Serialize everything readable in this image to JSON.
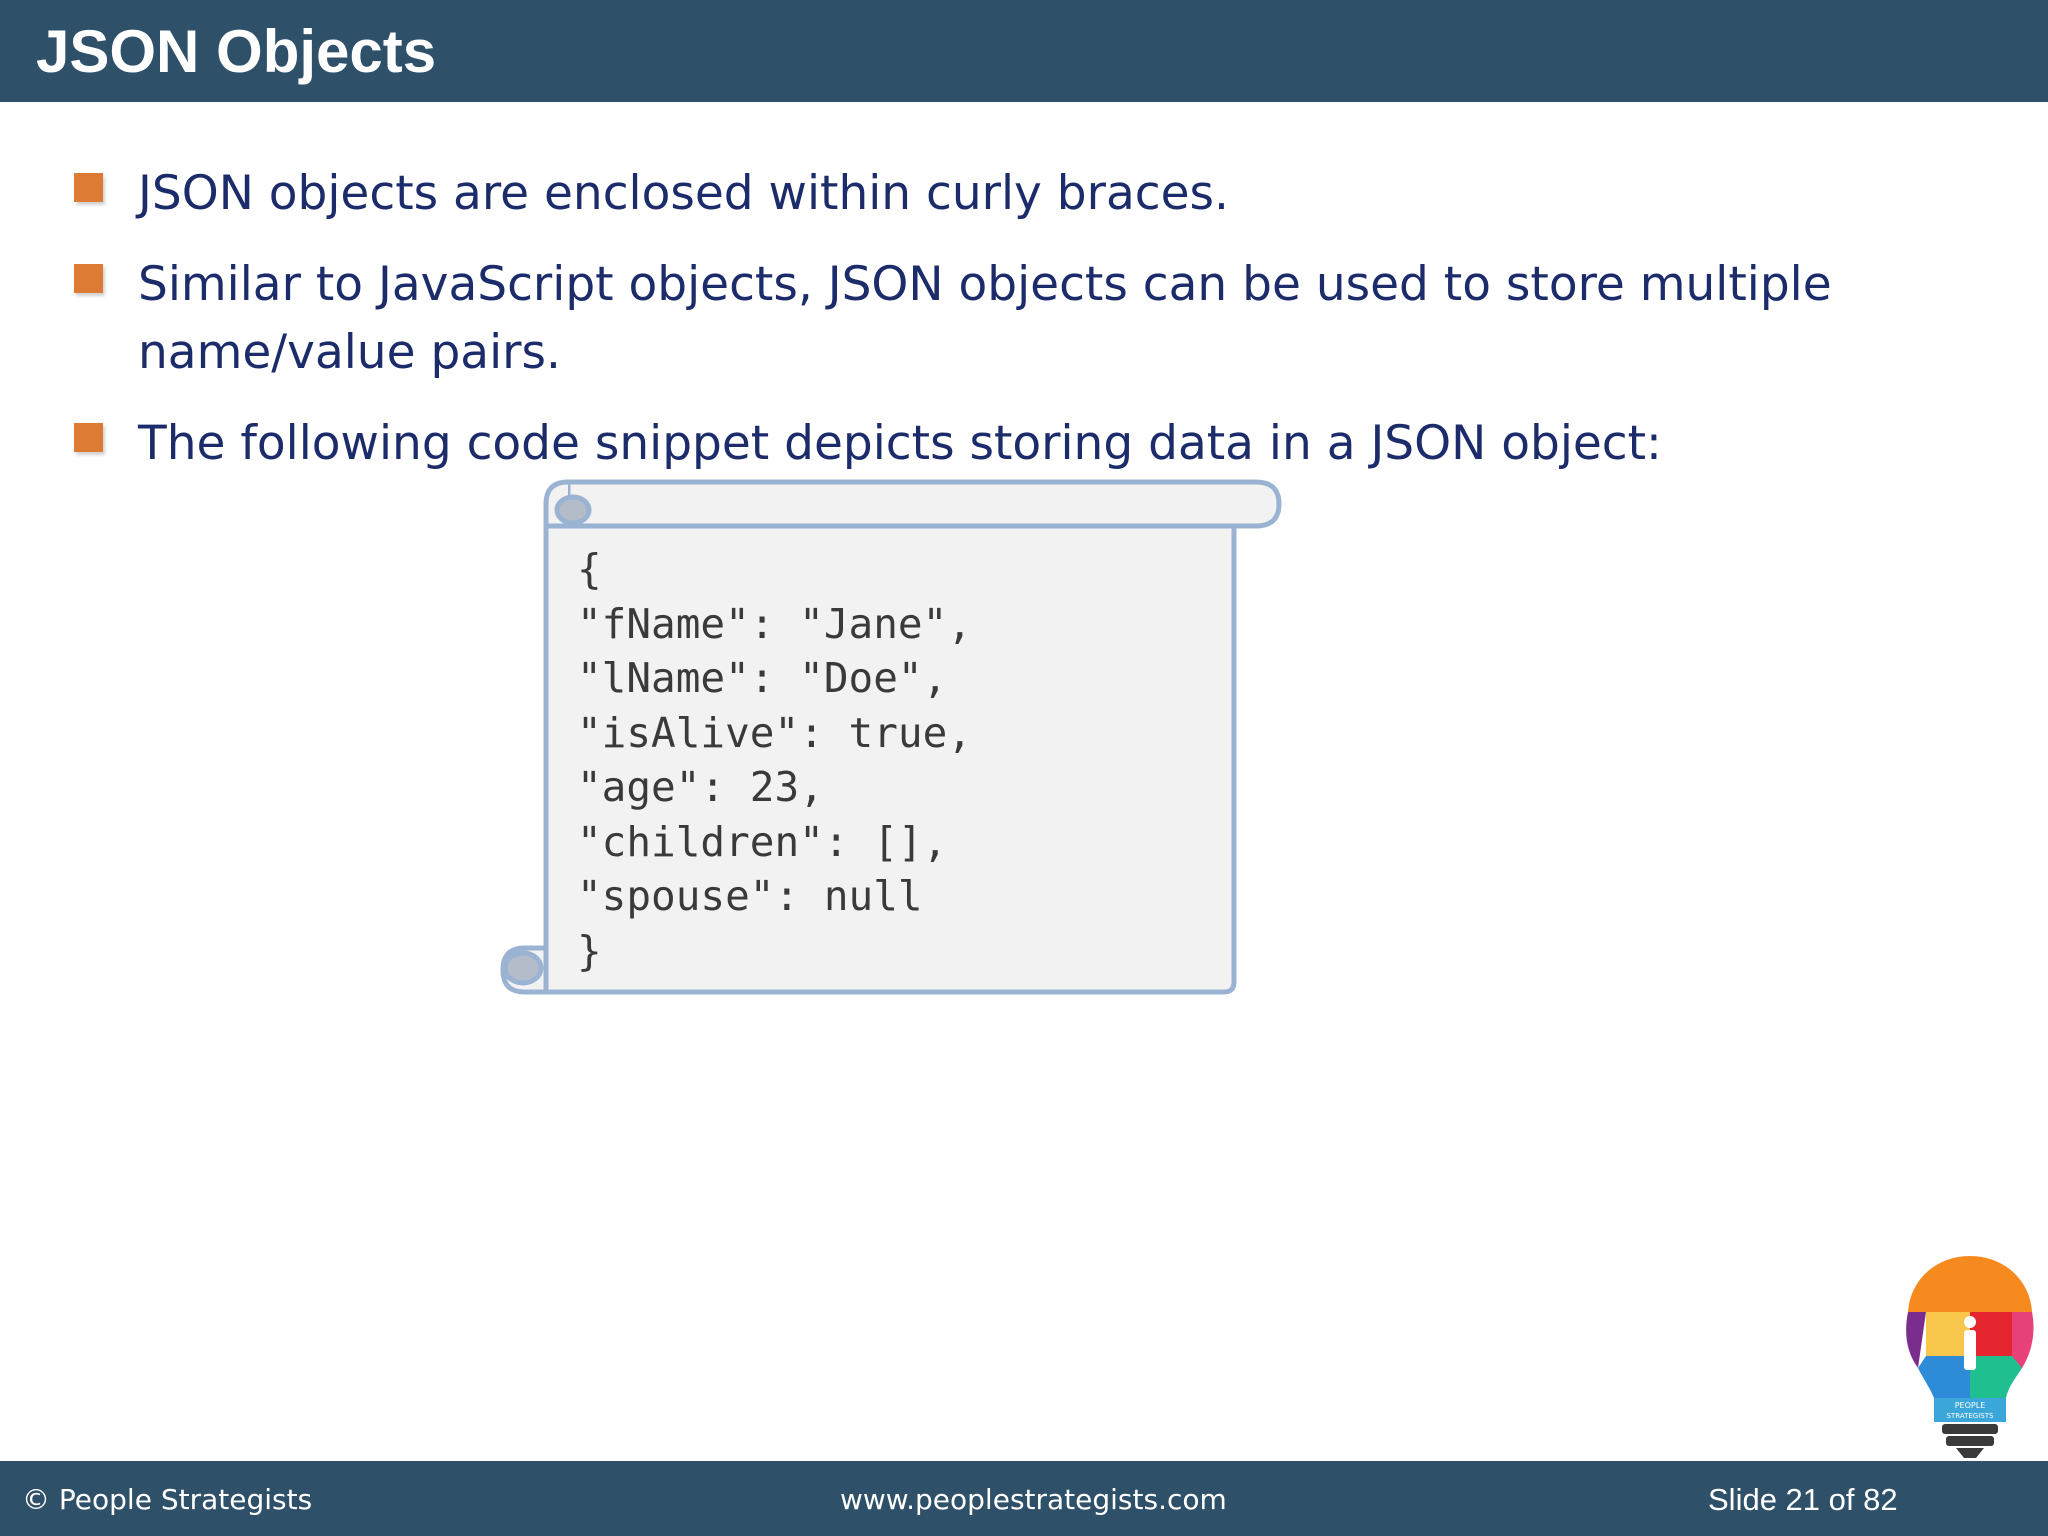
{
  "slide": {
    "title": "JSON Objects"
  },
  "bullets": [
    "JSON objects are enclosed within curly braces.",
    "Similar to JavaScript objects, JSON objects can be used to store multiple name/value pairs.",
    "The following code snippet depicts storing data in a JSON object:"
  ],
  "code_snippet": {
    "lines": [
      "{",
      "\"fName\": \"Jane\",",
      "\"lName\": \"Doe\",",
      "\"isAlive\": true,",
      "\"age\": 23,",
      "\"children\": [],",
      "\"spouse\": null",
      "}"
    ]
  },
  "footer": {
    "copyright": "© People Strategists",
    "website": "www.peoplestrategists.com",
    "slide_counter": "Slide 21 of 82"
  },
  "logo": {
    "icon": "lightbulb-puzzle-logo",
    "text_line1": "PEOPLE",
    "text_line2": "STRATEGISTS"
  },
  "colors": {
    "header_footer_bg": "#2e5069",
    "bullet_square": "#dd7a33",
    "bullet_text": "#1c2c6b",
    "scroll_fill": "#f2f2f3",
    "scroll_border": "#9ab3d3"
  }
}
